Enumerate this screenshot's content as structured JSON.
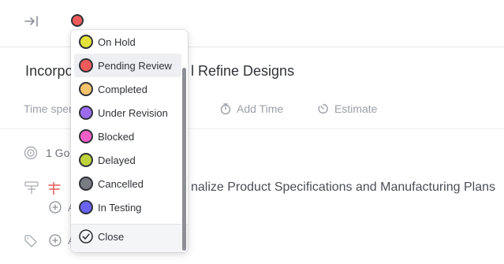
{
  "header": {
    "current_status_color": "#ef5b5b"
  },
  "task": {
    "title_left": "Incorpo",
    "title_right": "l Refine Designs",
    "time_spent_label": "Time sper",
    "add_time_label": "Add Time",
    "estimate_label": "Estimate",
    "goals_label": "1 Go",
    "add_label_1": "A",
    "add_label_2": "A",
    "linked_task_text": "nalize Product Specifications and Manufacturing Plans"
  },
  "status_menu": {
    "items": [
      {
        "label": "On Hold",
        "color": "#e4e23a"
      },
      {
        "label": "Pending Review",
        "color": "#ef5b5b"
      },
      {
        "label": "Completed",
        "color": "#f6c26b"
      },
      {
        "label": "Under Revision",
        "color": "#9b6cf0"
      },
      {
        "label": "Blocked",
        "color": "#ef5fc8"
      },
      {
        "label": "Delayed",
        "color": "#bfd13b"
      },
      {
        "label": "Cancelled",
        "color": "#7a7c84"
      },
      {
        "label": "In Testing",
        "color": "#6a63f2"
      }
    ],
    "close_label": "Close"
  }
}
